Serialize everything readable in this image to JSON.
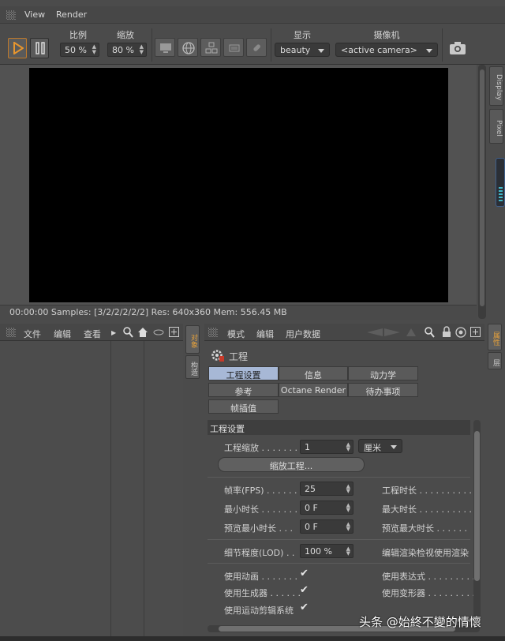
{
  "menubar": {
    "view": "View",
    "render": "Render"
  },
  "toolbar": {
    "scale_label": "比例",
    "scale_value": "50 %",
    "zoom_label": "缩放",
    "zoom_value": "80 %",
    "display_label": "显示",
    "display_value": "beauty",
    "camera_label": "摄像机",
    "camera_value": "<active camera>"
  },
  "side_tabs": {
    "display": "Display",
    "pixel": "Pixel"
  },
  "status": "00:00:00  Samples: [3/2/2/2/2/2]  Res: 640x360  Mem: 556.45 MB",
  "object_manager": {
    "menu": [
      "文件",
      "编辑",
      "查看"
    ],
    "side_tabs": [
      "对象",
      "构造"
    ]
  },
  "attributes": {
    "menu": [
      "模式",
      "编辑",
      "用户数据"
    ],
    "side_tabs": [
      "属性",
      "层"
    ],
    "title": "工程",
    "tabs_row1": [
      "工程设置",
      "信息",
      "动力学"
    ],
    "tabs_row2": [
      "参考",
      "Octane Render",
      "待办事项"
    ],
    "tabs_row3": [
      "帧插值"
    ],
    "section": "工程设置",
    "scale_label": "工程缩放 . . . . . . .",
    "scale_value": "1",
    "scale_unit": "厘米",
    "scale_button": "缩放工程...",
    "fps_label": "帧率(FPS) . . . . . .",
    "fps_value": "25",
    "project_time_label": "工程时长 . . . . . . . . . .",
    "min_time_label": "最小时长 . . . . . . .",
    "min_time_value": "0 F",
    "max_time_label": "最大时长 . . . . . . . . . .",
    "preview_min_label": "预览最小时长 . . .",
    "preview_min_value": "0 F",
    "preview_max_label": "预览最大时长 . . . . . .",
    "lod_label": "细节程度(LOD) . .",
    "lod_value": "100 %",
    "render_lod_label": "编辑渲染检视使用渲染",
    "use_anim_label": "使用动画 . . . . . . .",
    "use_expr_label": "使用表达式 . . . . . . . . .",
    "use_gen_label": "使用生成器 . . . . . .",
    "use_deform_label": "使用变形器 . . . . . . . . .",
    "use_motion_label": "使用运动剪辑系统",
    "check_glyph": "✔"
  },
  "watermark": "头条 @始終不變的情懷"
}
